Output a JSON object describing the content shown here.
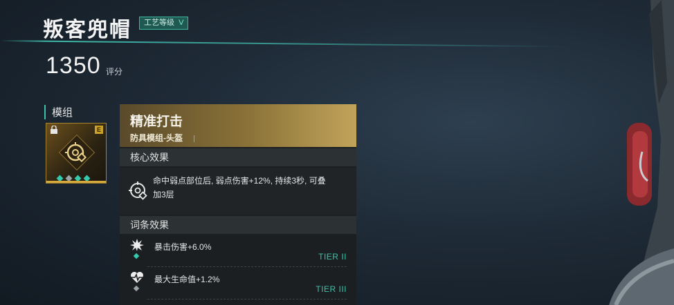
{
  "item": {
    "title": "叛客兜帽",
    "craft_badge": "工艺等级",
    "craft_level": "V",
    "score": "1350",
    "score_unit": "评分"
  },
  "module_section": {
    "label": "模组",
    "grade": "E",
    "pips": [
      "teal",
      "gray",
      "teal",
      "teal"
    ]
  },
  "detail_panel": {
    "title": "精准打击",
    "subtitle": "防具模组-头盔",
    "core_header": "核心效果",
    "core_text_line1": "命中弱点部位后, 弱点伤害+12%, 持续3秒, 可叠",
    "core_text_line2": "加3层",
    "attr_header": "词条效果",
    "attrs": [
      {
        "icon": "burst-icon",
        "text": "暴击伤害+6.0%",
        "tier_label": "TIER",
        "tier_numeral": "II",
        "pip": "teal"
      },
      {
        "icon": "heart-pulse-icon",
        "text": "最大生命值+1.2%",
        "tier_label": "TIER",
        "tier_numeral": "III",
        "pip": "gray"
      }
    ]
  },
  "colors": {
    "accent": "#37c4aa",
    "gold": "#c2a35a"
  }
}
